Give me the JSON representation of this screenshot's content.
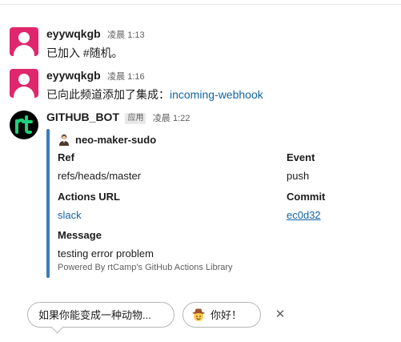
{
  "messages": [
    {
      "username": "eyywqkgb",
      "time": "凌晨 1:13",
      "text": "已加入 #随机。"
    },
    {
      "username": "eyywqkgb",
      "time": "凌晨 1:16",
      "text_prefix": "已向此频道添加了集成：",
      "link": "incoming-webhook"
    },
    {
      "username": "GITHUB_BOT",
      "badge": "应用",
      "time": "凌晨 1:22",
      "attachment": {
        "author": "neo-maker-sudo",
        "fields": {
          "ref_title": "Ref",
          "ref_value": "refs/heads/master",
          "event_title": "Event",
          "event_value": "push",
          "actions_title": "Actions URL",
          "actions_value": "slack",
          "commit_title": "Commit",
          "commit_value": "ec0d32",
          "message_title": "Message",
          "message_value": "testing error problem"
        },
        "footer": "Powered By rtCamp's GitHub Actions Library",
        "bar_color": "#3d7bb8"
      }
    }
  ],
  "suggestions": [
    {
      "label": "如果你能变成一种动物..."
    },
    {
      "label": "你好！",
      "icon": "cowboy-emoji-icon"
    }
  ],
  "colors": {
    "link": "#1264a3",
    "avatar_pink": "#e0266c",
    "text": "#1d1c1d",
    "muted": "#616061"
  }
}
